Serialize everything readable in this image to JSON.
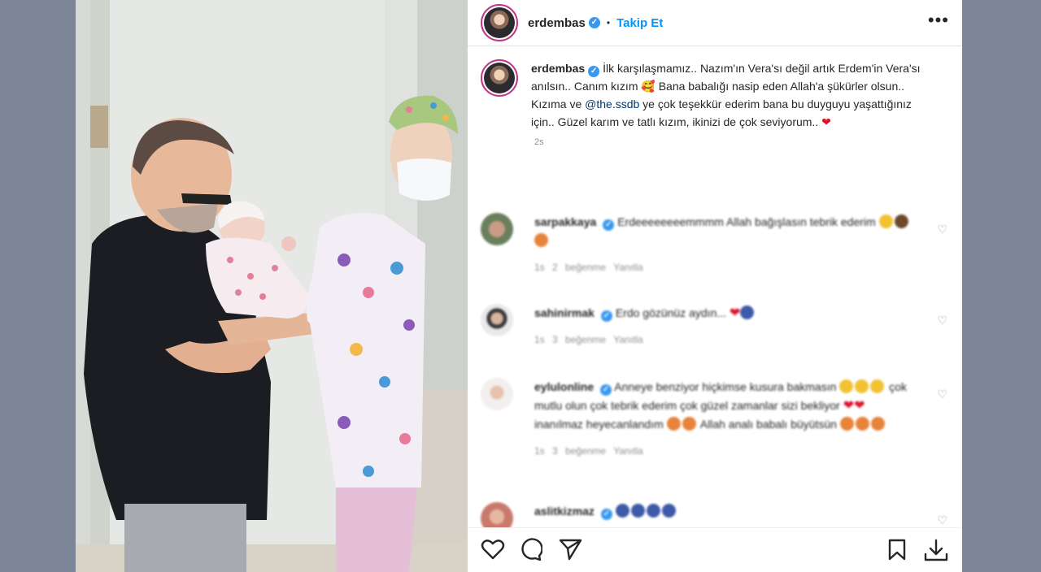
{
  "post": {
    "username": "erdembas",
    "follow_label": "Takip Et",
    "separator": "•",
    "more_label": "•••"
  },
  "caption": {
    "username": "erdembas",
    "text_1": "İlk karşılaşmamız.. Nazım'ın Vera'sı değil artık Erdem'in Vera'sı anılsın.. Canım kızım 🥰 Bana babalığı nasip eden Allah'a şükürler olsun.. Kızıma ve ",
    "mention": "@the.ssdb",
    "text_2": " ye çok teşekkür ederim bana bu duyguyu yaşattığınız için.. Güzel karım ve tatlı kızım, ikinizi de çok seviyorum.. ",
    "heart": "❤",
    "time": "2s"
  },
  "comments": [
    {
      "username": "sarpakkaya",
      "text": "Erdeeeeeeeemmmm Allah bağışlasın tebrik ederim",
      "age": "1s",
      "likes": "2 beğenme",
      "reply": "Yanıtla"
    },
    {
      "username": "sahinirmak",
      "text": "Erdo gözünüz aydın...",
      "age": "1s",
      "likes": "3 beğenme",
      "reply": "Yanıtla"
    },
    {
      "username": "eylulonline",
      "text": "Anneye benziyor hiçkimse kusura bakmasın",
      "text_b": "çok mutlu olun çok tebrik ederim çok güzel zamanlar sizi bekliyor",
      "text_c": "inanılmaz heyecanlandım",
      "text_d": "Allah analı babalı büyütsün",
      "age": "1s",
      "likes": "3 beğenme",
      "reply": "Yanıtla"
    },
    {
      "username": "aslitkizmaz"
    }
  ],
  "colors": {
    "link": "#0095f6",
    "mention": "#00376b",
    "verified": "#3897f0",
    "background": "#7d8699"
  },
  "icons": [
    "heart-icon",
    "comment-icon",
    "share-icon",
    "bookmark-icon",
    "download-icon"
  ]
}
